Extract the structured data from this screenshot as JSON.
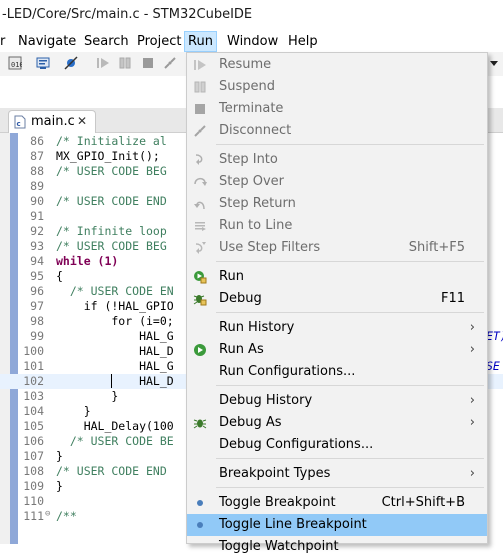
{
  "window": {
    "title": "-LED/Core/Src/main.c - STM32CubeIDE"
  },
  "menubar": {
    "items": [
      {
        "label": "r"
      },
      {
        "label": "Navigate"
      },
      {
        "label": "Search"
      },
      {
        "label": "Project"
      },
      {
        "label": "Run"
      },
      {
        "label": "Window"
      },
      {
        "label": "Help"
      }
    ]
  },
  "editor": {
    "tab": {
      "label": "main.c",
      "close": "✕"
    },
    "lines": [
      {
        "num": "86",
        "text": "/* Initialize al",
        "cls": "cm"
      },
      {
        "num": "87",
        "text": "MX_GPIO_Init();",
        "cls": "fn"
      },
      {
        "num": "88",
        "text": "/* USER CODE BEG",
        "cls": "cm"
      },
      {
        "num": "89",
        "text": "",
        "cls": "fn"
      },
      {
        "num": "90",
        "text": "/* USER CODE END",
        "cls": "cm"
      },
      {
        "num": "91",
        "text": "",
        "cls": "fn"
      },
      {
        "num": "92",
        "text": "/* Infinite loop",
        "cls": "cm"
      },
      {
        "num": "93",
        "text": "/* USER CODE BEG",
        "cls": "cm"
      },
      {
        "num": "94",
        "text": "while (1)",
        "cls": "kw"
      },
      {
        "num": "95",
        "text": "{",
        "cls": "fn"
      },
      {
        "num": "96",
        "text": "  /* USER CODE EN",
        "cls": "cm"
      },
      {
        "num": "97",
        "text": "    if (!HAL_GPIO",
        "cls": "fn"
      },
      {
        "num": "98",
        "text": "        for (i=0;",
        "cls": "fn"
      },
      {
        "num": "99",
        "text": "            HAL_G",
        "cls": "fn"
      },
      {
        "num": "100",
        "text": "            HAL_D",
        "cls": "fn"
      },
      {
        "num": "101",
        "text": "            HAL_G",
        "cls": "fn"
      },
      {
        "num": "102",
        "text": "            HAL_D",
        "cls": "fn"
      },
      {
        "num": "103",
        "text": "        }",
        "cls": "fn"
      },
      {
        "num": "104",
        "text": "    }",
        "cls": "fn"
      },
      {
        "num": "105",
        "text": "    HAL_Delay(100",
        "cls": "fn"
      },
      {
        "num": "106",
        "text": "  /* USER CODE BE",
        "cls": "cm"
      },
      {
        "num": "107",
        "text": "}",
        "cls": "fn"
      },
      {
        "num": "108",
        "text": "/* USER CODE END",
        "cls": "cm"
      },
      {
        "num": "109",
        "text": "}",
        "cls": "fn"
      },
      {
        "num": "110",
        "text": "",
        "cls": "fn"
      },
      {
        "num": "111",
        "text": "/**",
        "cls": "cm"
      }
    ],
    "right_fragments": [
      {
        "line": "99",
        "text": "ET)"
      },
      {
        "line": "101",
        "text": "SE"
      }
    ]
  },
  "run_menu": {
    "items": [
      {
        "label": "Resume",
        "icon": "resume-icon",
        "disabled": true
      },
      {
        "label": "Suspend",
        "icon": "suspend-icon",
        "disabled": true
      },
      {
        "label": "Terminate",
        "icon": "terminate-icon",
        "disabled": true
      },
      {
        "label": "Disconnect",
        "icon": "disconnect-icon",
        "disabled": true
      },
      {
        "label": "Step Into",
        "icon": "step-into-icon",
        "disabled": true
      },
      {
        "label": "Step Over",
        "icon": "step-over-icon",
        "disabled": true
      },
      {
        "label": "Step Return",
        "icon": "step-return-icon",
        "disabled": true
      },
      {
        "label": "Run to Line",
        "icon": "run-to-line-icon",
        "disabled": true
      },
      {
        "label": "Use Step Filters",
        "icon": "step-filters-icon",
        "disabled": true,
        "accel": "Shift+F5"
      },
      {
        "label": "Run",
        "icon": "run-icon"
      },
      {
        "label": "Debug",
        "icon": "debug-icon",
        "accel": "F11"
      },
      {
        "label": "Run History",
        "submenu": true
      },
      {
        "label": "Run As",
        "icon": "run-as-icon",
        "submenu": true
      },
      {
        "label": "Run Configurations..."
      },
      {
        "label": "Debug History",
        "submenu": true
      },
      {
        "label": "Debug As",
        "icon": "debug-as-icon",
        "submenu": true
      },
      {
        "label": "Debug Configurations..."
      },
      {
        "label": "Breakpoint Types",
        "submenu": true
      },
      {
        "label": "Toggle Breakpoint",
        "icon": "breakpoint-dot-icon",
        "accel": "Ctrl+Shift+B"
      },
      {
        "label": "Toggle Line Breakpoint",
        "icon": "breakpoint-dot-icon",
        "highlighted": true
      },
      {
        "label": "Toggle Watchpoint"
      }
    ]
  },
  "colors": {
    "highlight": "#91c9f7",
    "menu_bg": "#f2f2f2",
    "disabled_text": "#6d6d6d"
  }
}
